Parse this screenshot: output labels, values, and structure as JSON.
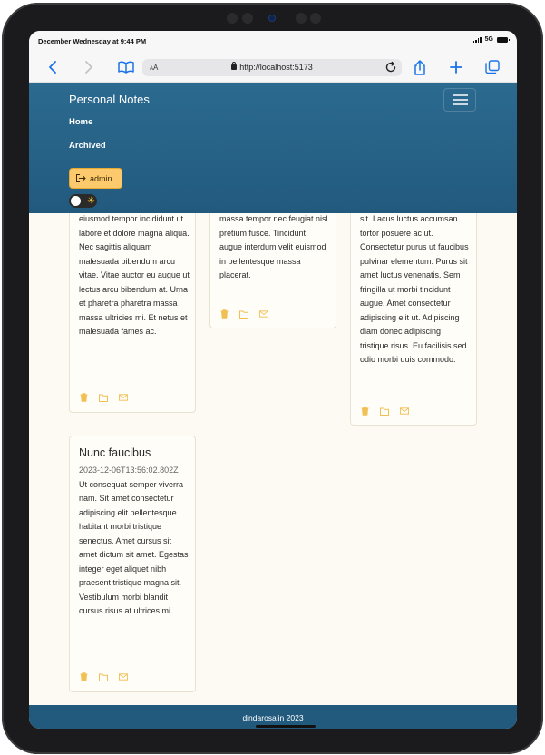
{
  "status_bar": {
    "time": "December Wednesday at 9:44 PM",
    "network": "5G"
  },
  "browser": {
    "text_size_label": "AA",
    "url": "http://localhost:5173"
  },
  "app": {
    "brand": "Personal Notes",
    "nav": [
      {
        "label": "Home"
      },
      {
        "label": "Archived"
      }
    ],
    "user_button": "admin",
    "theme_icon": "sun-icon"
  },
  "notes": [
    {
      "body": "eiusmod tempor incididunt ut labore et dolore magna aliqua. Nec sagittis aliquam malesuada bibendum arcu vitae. Vitae auctor eu augue ut lectus arcu bibendum at. Urna et pharetra pharetra massa massa ultricies mi. Et netus et malesuada fames ac."
    },
    {
      "body": "massa tempor nec feugiat nisl pretium fusce. Tincidunt augue interdum velit euismod in pellentesque massa placerat."
    },
    {
      "body": "sit. Lacus luctus accumsan tortor posuere ac ut. Consectetur purus ut faucibus pulvinar elementum. Purus sit amet luctus venenatis. Sem fringilla ut morbi tincidunt augue. Amet consectetur adipiscing elit ut. Adipiscing diam donec adipiscing tristique risus. Eu facilisis sed odio morbi quis commodo."
    },
    {
      "title": "Nunc faucibus",
      "date": "2023-12-06T13:56:02.802Z",
      "body": "Ut consequat semper viverra nam. Sit amet consectetur adipiscing elit pellentesque habitant morbi tristique senectus. Amet cursus sit amet dictum sit amet. Egestas integer eget aliquet nibh praesent tristique magna sit. Vestibulum morbi blandit cursus risus at ultrices mi"
    }
  ],
  "note_actions": [
    "delete-icon",
    "archive-icon",
    "mail-icon"
  ],
  "footer": {
    "text": "dindarosalin 2023"
  },
  "colors": {
    "header": "#225a7e",
    "accent": "#fcc96c",
    "page_bg": "#fdfaf3",
    "action_icon": "#f1c053"
  }
}
